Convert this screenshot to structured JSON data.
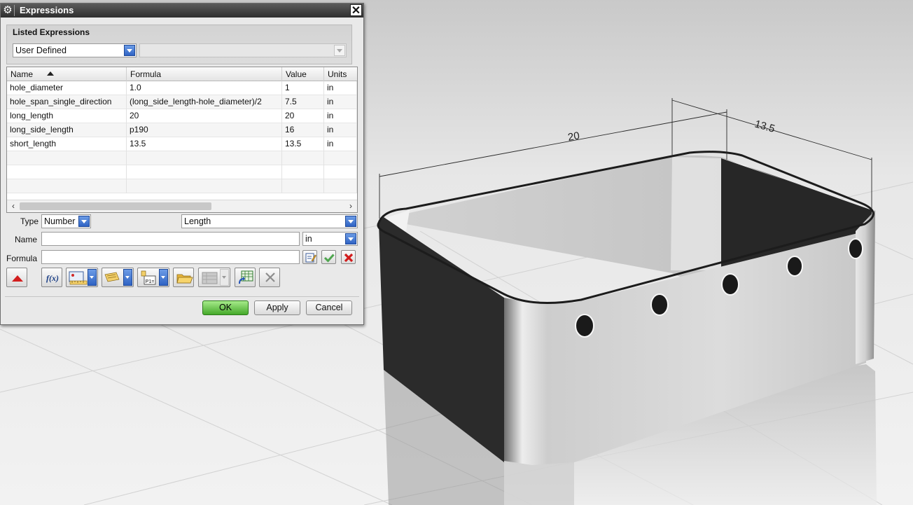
{
  "dialog": {
    "title": "Expressions",
    "close_symbol": "✕",
    "listed_group_title": "Listed Expressions",
    "listed_filter_value": "User Defined",
    "secondary_filter_value": ""
  },
  "table": {
    "columns": [
      "Name",
      "Formula",
      "Value",
      "Units"
    ],
    "sort_column": "Name",
    "rows": [
      [
        "hole_diameter",
        "1.0",
        "1",
        "in"
      ],
      [
        "hole_span_single_direction",
        "(long_side_length-hole_diameter)/2",
        "7.5",
        "in"
      ],
      [
        "long_length",
        "20",
        "20",
        "in"
      ],
      [
        "long_side_length",
        "p190",
        "16",
        "in"
      ],
      [
        "short_length",
        "13.5",
        "13.5",
        "in"
      ]
    ],
    "scroll_left": "‹",
    "scroll_right": "›"
  },
  "form": {
    "type_label": "Type",
    "type_value": "Number",
    "dimension_value": "Length",
    "name_label": "Name",
    "name_value": "",
    "units_value": "in",
    "formula_label": "Formula",
    "formula_value": ""
  },
  "toolbar": {
    "fx_label": "f(x)"
  },
  "buttons": {
    "ok": "OK",
    "apply": "Apply",
    "cancel": "Cancel"
  },
  "viewport": {
    "dim_long": "20",
    "dim_short": "13.5"
  },
  "colors": {
    "title_bar": "#3a3a3a",
    "accent_blue": "#2f63c4",
    "ok_green": "#45a92a",
    "reject_red": "#d11c1c"
  },
  "icons": [
    "gear-icon",
    "close-icon",
    "collapse-up-icon",
    "function-icon",
    "measure-icon",
    "list-icon",
    "parameter-icon",
    "open-folder-icon",
    "spreadsheet-icon",
    "refresh-grid-icon",
    "delete-icon",
    "edit-formula-icon",
    "accept-check-icon",
    "reject-x-icon"
  ]
}
